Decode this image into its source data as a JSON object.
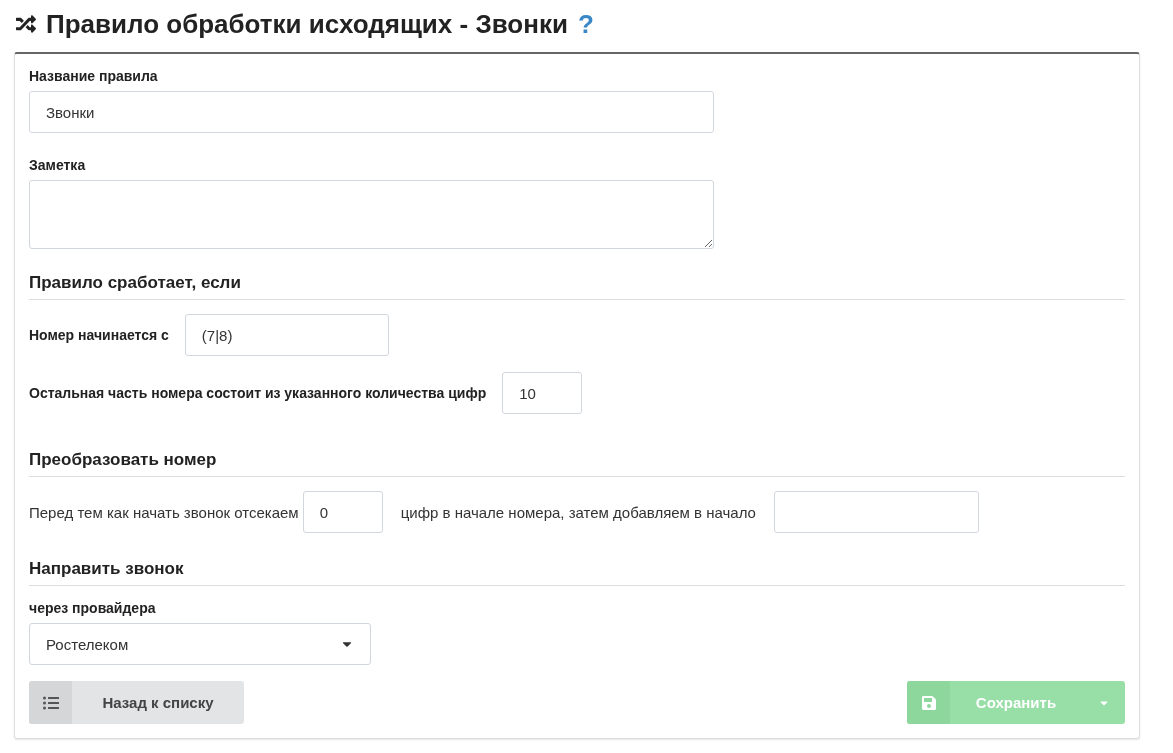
{
  "page": {
    "title": "Правило обработки исходящих - Звонки",
    "help": "?"
  },
  "name_field": {
    "label": "Название правила",
    "value": "Звонки"
  },
  "note_field": {
    "label": "Заметка"
  },
  "sections": [
    {
      "title": "Правило сработает, если",
      "kind": "conditions",
      "rows": [
        {
          "label": "Номер начинается с",
          "value": "(7|8)"
        },
        {
          "label": "Остальная часть номера состоит из указанного количества цифр",
          "value": "10"
        }
      ]
    },
    {
      "title": "Преобразовать номер",
      "kind": "sentence",
      "parts": [
        {
          "kind": "text",
          "text": "Перед тем как начать звонок отсекаем"
        },
        {
          "kind": "input",
          "value": "0"
        },
        {
          "kind": "text",
          "text": "цифр в начале номера, затем добавляем в начало"
        },
        {
          "kind": "input"
        }
      ]
    },
    {
      "title": "Направить звонок",
      "kind": "route",
      "label": "через провайдера",
      "value": "Ростелеком"
    }
  ],
  "buttons": {
    "back": {
      "label": "Назад к списку"
    },
    "save": {
      "label": "Сохранить",
      "disabled": true
    }
  }
}
